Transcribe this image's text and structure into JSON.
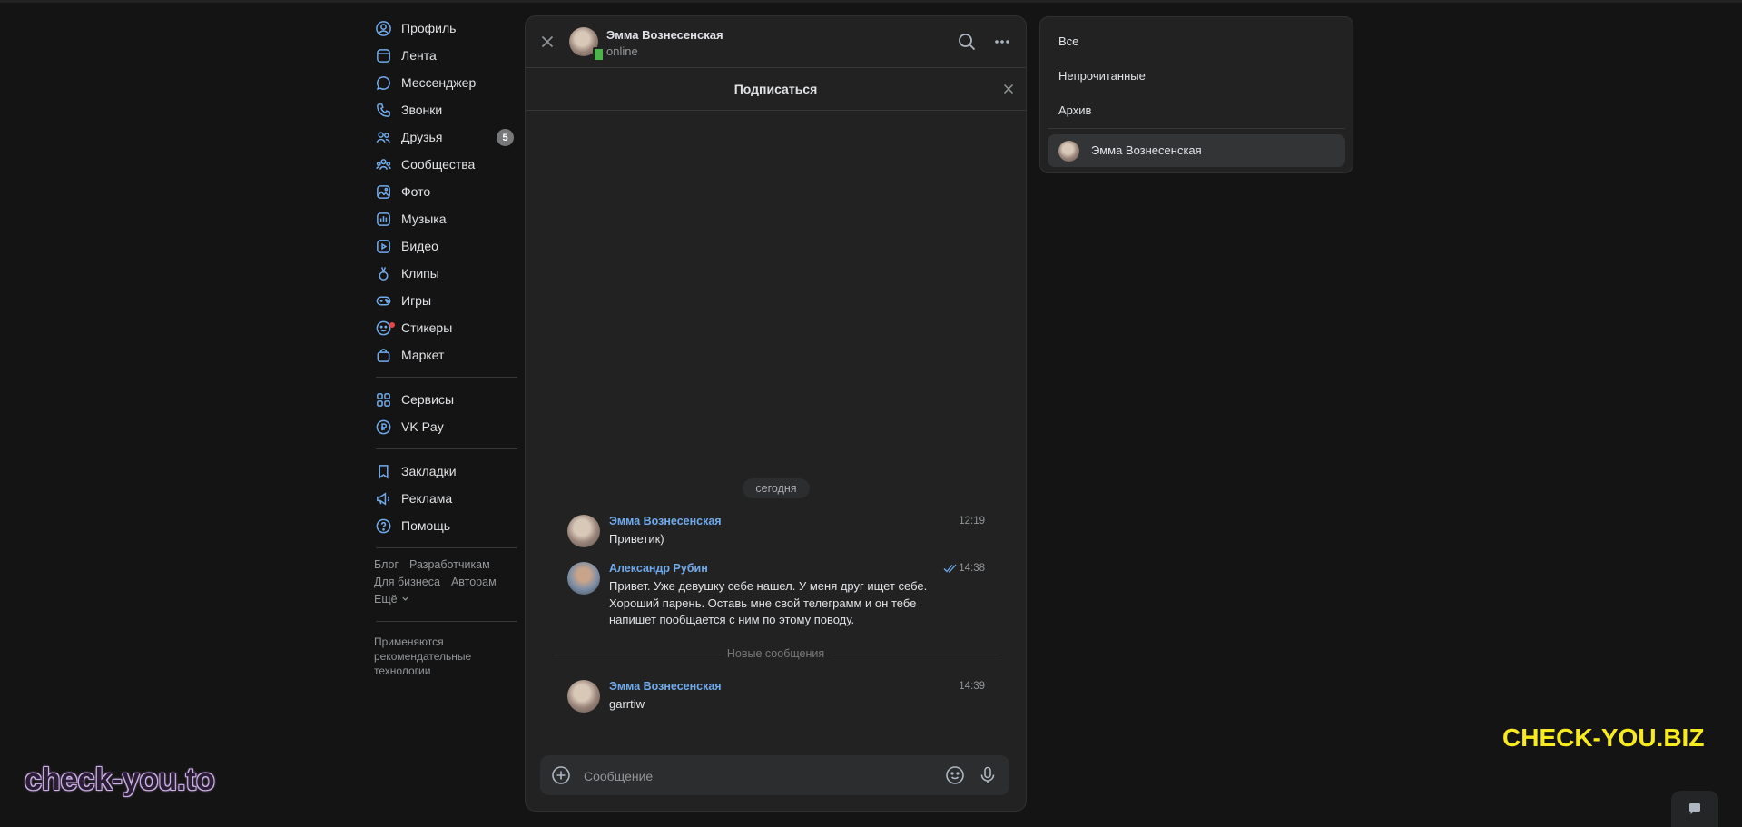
{
  "nav": {
    "main": [
      {
        "label": "Профиль",
        "icon": "profile-icon"
      },
      {
        "label": "Лента",
        "icon": "feed-icon"
      },
      {
        "label": "Мессенджер",
        "icon": "messenger-icon"
      },
      {
        "label": "Звонки",
        "icon": "phone-icon"
      },
      {
        "label": "Друзья",
        "icon": "friends-icon",
        "badge": "5"
      },
      {
        "label": "Сообщества",
        "icon": "communities-icon"
      },
      {
        "label": "Фото",
        "icon": "photo-icon"
      },
      {
        "label": "Музыка",
        "icon": "music-icon"
      },
      {
        "label": "Видео",
        "icon": "video-icon"
      },
      {
        "label": "Клипы",
        "icon": "clips-icon"
      },
      {
        "label": "Игры",
        "icon": "games-icon"
      },
      {
        "label": "Стикеры",
        "icon": "stickers-icon"
      },
      {
        "label": "Маркет",
        "icon": "market-icon"
      }
    ],
    "secondary": [
      {
        "label": "Сервисы",
        "icon": "services-icon"
      },
      {
        "label": "VK Pay",
        "icon": "vkpay-icon"
      }
    ],
    "tertiary": [
      {
        "label": "Закладки",
        "icon": "bookmark-icon"
      },
      {
        "label": "Реклама",
        "icon": "megaphone-icon"
      },
      {
        "label": "Помощь",
        "icon": "help-icon"
      }
    ],
    "footer": {
      "blog": "Блог",
      "developers": "Разработчикам",
      "business": "Для бизнеса",
      "authors": "Авторам",
      "more": "Ещё"
    },
    "rec_note": "Применяются рекомендательные технологии"
  },
  "chat": {
    "header": {
      "name": "Эмма Вознесенская",
      "status": "online"
    },
    "subscribe_label": "Подписаться",
    "date_label": "сегодня",
    "new_messages_label": "Новые сообщения",
    "messages": [
      {
        "author": "Эмма Вознесенская",
        "time": "12:19",
        "text": "Приветик)"
      },
      {
        "author": "Александр Рубин",
        "time": "14:38",
        "text": "Привет. Уже девушку себе нашел. У меня друг ищет себе. Хороший парень. Оставь мне свой телеграмм и он тебе напишет пообщается с ним по этому поводу."
      },
      {
        "author": "Эмма Вознесенская",
        "time": "14:39",
        "text": "garrtiw"
      }
    ],
    "composer": {
      "placeholder": "Сообщение",
      "value": ""
    }
  },
  "folders": {
    "items": [
      "Все",
      "Непрочитанные",
      "Архив"
    ],
    "active_chat": "Эмма Вознесенская"
  },
  "watermarks": {
    "left": "check-you.to",
    "right": "CHECK-YOU.BIZ"
  },
  "colors": {
    "background": "#141414",
    "panel": "#222222",
    "accent": "#71aaeb",
    "online": "#4bb34b",
    "watermark_right": "#f7ea1f"
  }
}
